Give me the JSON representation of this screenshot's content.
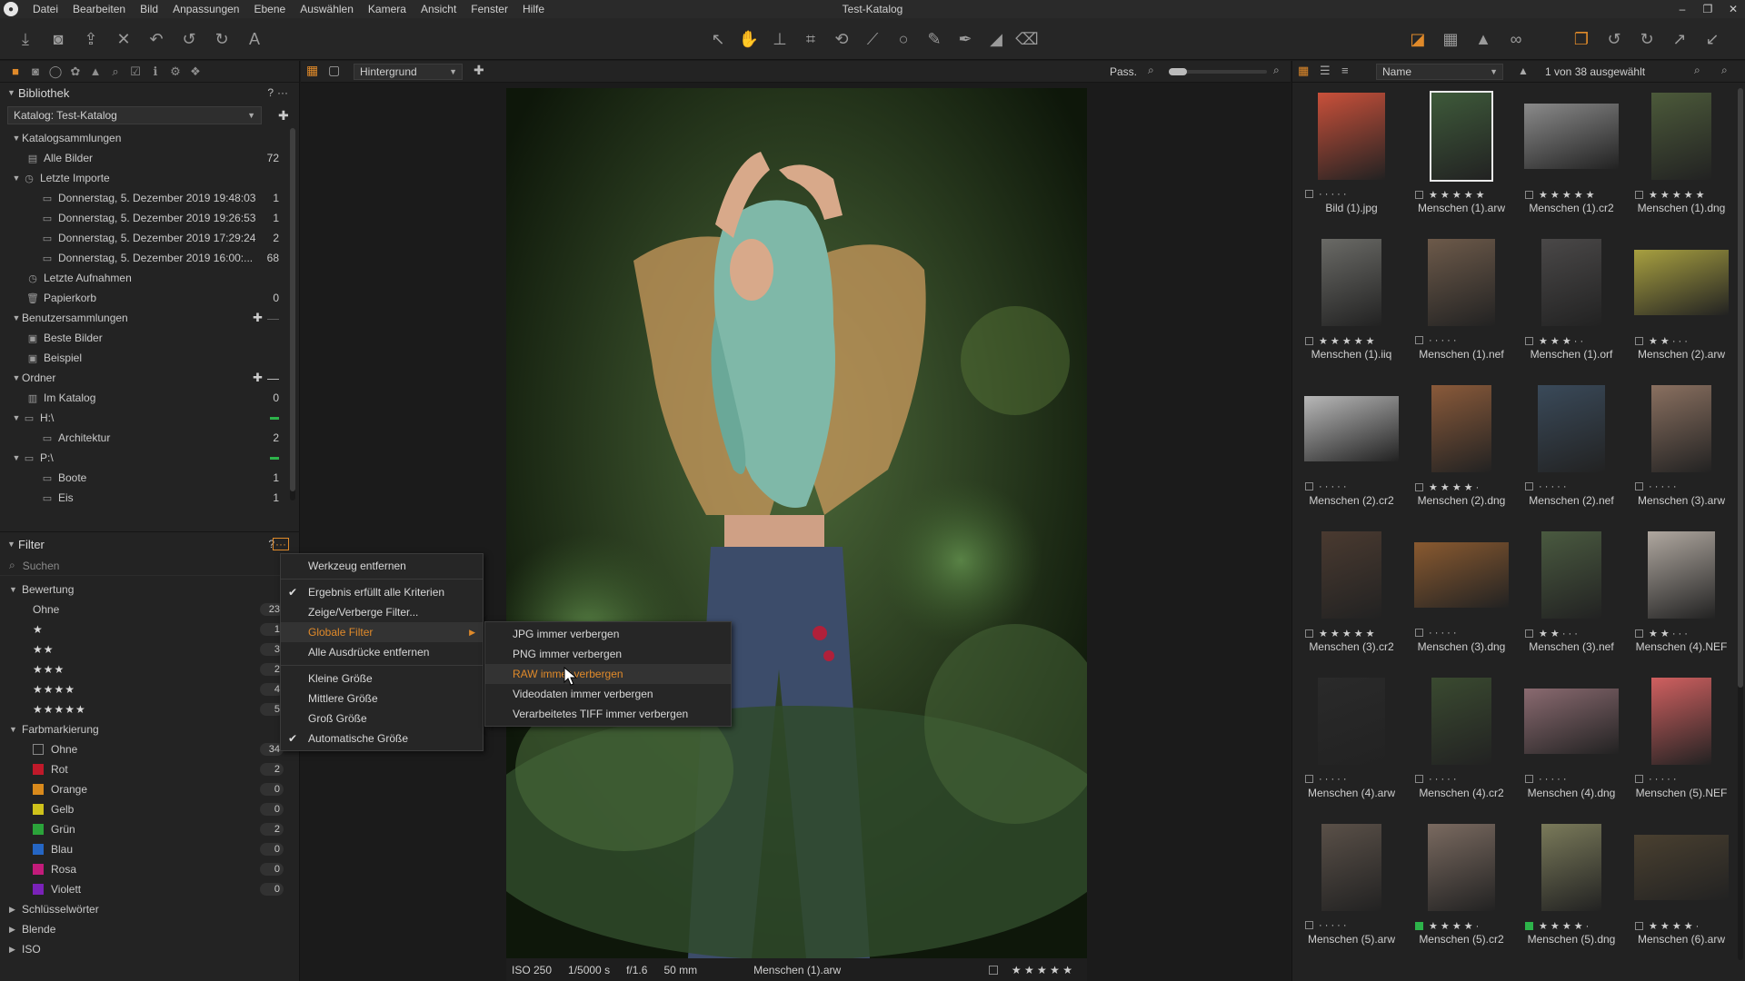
{
  "app": {
    "window_title": "Test-Katalog",
    "menu": [
      "Datei",
      "Bearbeiten",
      "Bild",
      "Anpassungen",
      "Ebene",
      "Auswählen",
      "Kamera",
      "Ansicht",
      "Fenster",
      "Hilfe"
    ]
  },
  "library": {
    "title": "Bibliothek",
    "help": "?",
    "more": "···",
    "catalog_dropdown": "Katalog: Test-Katalog",
    "catalog_collections": {
      "label": "Katalogsammlungen",
      "all_images": {
        "label": "Alle Bilder",
        "count": "72"
      },
      "recent_imports": {
        "label": "Letzte Importe",
        "items": [
          {
            "label": "Donnerstag, 5. Dezember 2019 19:48:03",
            "count": "1"
          },
          {
            "label": "Donnerstag, 5. Dezember 2019 19:26:53",
            "count": "1"
          },
          {
            "label": "Donnerstag, 5. Dezember 2019 17:29:24",
            "count": "2"
          },
          {
            "label": "Donnerstag, 5. Dezember 2019 16:00:...",
            "count": "68"
          }
        ]
      },
      "recent_captures": {
        "label": "Letzte Aufnahmen"
      },
      "trash": {
        "label": "Papierkorb",
        "count": "0"
      }
    },
    "user_collections": {
      "label": "Benutzersammlungen",
      "items": [
        {
          "label": "Beste Bilder"
        },
        {
          "label": "Beispiel"
        }
      ]
    },
    "folders": {
      "label": "Ordner",
      "in_catalog": {
        "label": "Im Katalog",
        "count": "0"
      },
      "drive_h": {
        "label": "H:\\",
        "children": [
          {
            "label": "Architektur",
            "count": "2"
          }
        ]
      },
      "drive_p": {
        "label": "P:\\",
        "children": [
          {
            "label": "Boote",
            "count": "1"
          },
          {
            "label": "Eis",
            "count": "1"
          }
        ]
      }
    }
  },
  "filter": {
    "title": "Filter",
    "help": "?",
    "more": "···",
    "search_placeholder": "Suchen",
    "rating": {
      "label": "Bewertung",
      "rows": [
        {
          "label": "Ohne",
          "count": "23"
        },
        {
          "stars": "★",
          "count": "1"
        },
        {
          "stars": "★★",
          "count": "3"
        },
        {
          "stars": "★★★",
          "count": "2"
        },
        {
          "stars": "★★★★",
          "count": "4"
        },
        {
          "stars": "★★★★★",
          "count": "5"
        }
      ]
    },
    "color_label": {
      "label": "Farbmarkierung",
      "rows": [
        {
          "label": "Ohne",
          "count": "34",
          "color": ""
        },
        {
          "label": "Rot",
          "count": "2",
          "color": "#c0192a"
        },
        {
          "label": "Orange",
          "count": "0",
          "color": "#d98a1c"
        },
        {
          "label": "Gelb",
          "count": "0",
          "color": "#cfc21b"
        },
        {
          "label": "Grün",
          "count": "2",
          "color": "#2ba33a"
        },
        {
          "label": "Blau",
          "count": "0",
          "color": "#2566c4"
        },
        {
          "label": "Rosa",
          "count": "0",
          "color": "#c21b7a"
        },
        {
          "label": "Violett",
          "count": "0",
          "color": "#7a22b8"
        }
      ]
    },
    "collapsed": [
      "Schlüsselwörter",
      "Blende",
      "ISO"
    ]
  },
  "viewer": {
    "layer_dropdown": "Hintergrund",
    "zoom_label": "Pass.",
    "status": {
      "iso": "ISO 250",
      "shutter": "1/5000 s",
      "aperture": "f/1.6",
      "focal": "50 mm",
      "filename": "Menschen (1).arw",
      "stars": "★ ★ ★ ★ ★"
    }
  },
  "context_menu": {
    "items": [
      {
        "label": "Werkzeug entfernen"
      },
      {
        "label": "Ergebnis erfüllt alle Kriterien",
        "checked": true
      },
      {
        "label": "Zeige/Verberge Filter..."
      },
      {
        "label": "Globale Filter",
        "submenu": true
      },
      {
        "label": "Alle Ausdrücke entfernen"
      },
      {
        "label": "Kleine Größe"
      },
      {
        "label": "Mittlere Größe"
      },
      {
        "label": "Groß Größe"
      },
      {
        "label": "Automatische Größe",
        "checked": true
      }
    ],
    "submenu": [
      {
        "label": "JPG immer verbergen"
      },
      {
        "label": "PNG immer verbergen"
      },
      {
        "label": "RAW immer verbergen"
      },
      {
        "label": "Videodaten immer verbergen"
      },
      {
        "label": "Verarbeitetes TIFF immer verbergen"
      }
    ]
  },
  "browser": {
    "sort_dropdown": "Name",
    "selection_status": "1 von 38 ausgewählt",
    "thumbnails": [
      {
        "name": "Bild (1).jpg",
        "stars": "· · · · ·",
        "color": "#c9503a"
      },
      {
        "name": "Menschen (1).arw",
        "stars": "★ ★ ★ ★ ★",
        "color": "#3e5a3a"
      },
      {
        "name": "Menschen (1).cr2",
        "stars": "★ ★ ★ ★ ★",
        "color": "#8a8a8a"
      },
      {
        "name": "Menschen (1).dng",
        "stars": "★ ★ ★ ★ ★",
        "color": "#4c5a3a"
      },
      {
        "name": "Menschen (1).iiq",
        "stars": "★ ★ ★ ★ ★",
        "color": "#6a6a66"
      },
      {
        "name": "Menschen (1).nef",
        "stars": "· · · · ·",
        "color": "#6d5a4a"
      },
      {
        "name": "Menschen (1).orf",
        "stars": "★ ★ ★ · ·",
        "color": "#4a4848"
      },
      {
        "name": "Menschen (2).arw",
        "stars": "★ ★ · · ·",
        "color": "#a8a040"
      },
      {
        "name": "Menschen (2).cr2",
        "stars": "· · · · ·",
        "color": "#b8b8b8"
      },
      {
        "name": "Menschen (2).dng",
        "stars": "★ ★ ★ ★ ·",
        "color": "#8a5a3a"
      },
      {
        "name": "Menschen (2).nef",
        "stars": "· · · · ·",
        "color": "#3a4a5a"
      },
      {
        "name": "Menschen (3).arw",
        "stars": "· · · · ·",
        "color": "#8a7060"
      },
      {
        "name": "Menschen (3).cr2",
        "stars": "★ ★ ★ ★ ★",
        "color": "#4a3a30"
      },
      {
        "name": "Menschen (3).dng",
        "stars": "· · · · ·",
        "color": "#8a5a30"
      },
      {
        "name": "Menschen (3).nef",
        "stars": "★ ★ · · ·",
        "color": "#4a5a40"
      },
      {
        "name": "Menschen (4).NEF",
        "stars": "★ ★ · · ·",
        "color": "#b0a8a0"
      },
      {
        "name": "Menschen (4).arw",
        "stars": "· · · · ·",
        "color": "#2a2a2a"
      },
      {
        "name": "Menschen (4).cr2",
        "stars": "· · · · ·",
        "color": "#3a4a30"
      },
      {
        "name": "Menschen (4).dng",
        "stars": "· · · · ·",
        "color": "#8a6a70"
      },
      {
        "name": "Menschen (5).NEF",
        "stars": "· · · · ·",
        "color": "#d06060"
      },
      {
        "name": "Menschen (5).arw",
        "stars": "· · · · ·",
        "color": "#5a5048"
      },
      {
        "name": "Menschen (5).cr2",
        "stars": "★ ★ ★ ★ ·",
        "color": "#7a6a60",
        "green": true
      },
      {
        "name": "Menschen (5).dng",
        "stars": "★ ★ ★ ★ ·",
        "color": "#7a7a5a",
        "green": true
      },
      {
        "name": "Menschen (6).arw",
        "stars": "★ ★ ★ ★ ·",
        "color": "#4a4030"
      }
    ]
  }
}
